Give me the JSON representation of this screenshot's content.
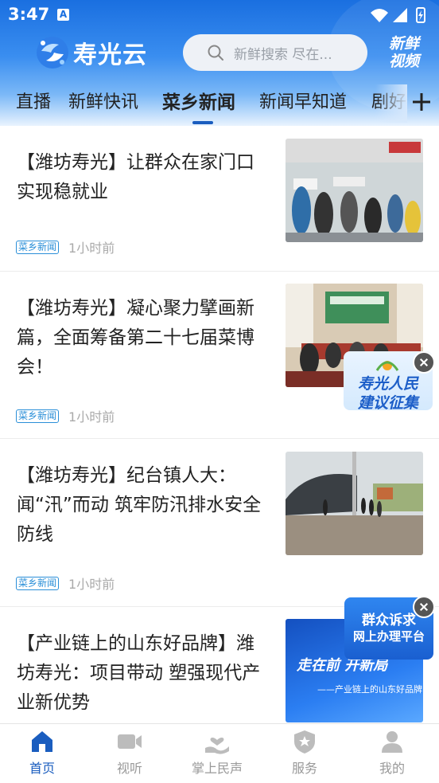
{
  "status": {
    "time": "3:47",
    "indicator": "A"
  },
  "header": {
    "app_name": "寿光云",
    "search_placeholder": "新鲜搜索  尽在...",
    "fresh_video": [
      "新鲜",
      "视频"
    ]
  },
  "tabs": [
    {
      "label": "直播"
    },
    {
      "label": "新鲜快讯"
    },
    {
      "label": "菜乡新闻",
      "active": true
    },
    {
      "label": "新闻早知道"
    },
    {
      "label": "剧好"
    }
  ],
  "articles": [
    {
      "title": "【潍坊寿光】让群众在家门口实现稳就业",
      "tag": "菜乡新闻",
      "time": "1小时前",
      "image": "job-fair-photo"
    },
    {
      "title": "【潍坊寿光】凝心聚力擘画新篇，全面筹备第二十七届菜博会！",
      "tag": "菜乡新闻",
      "time": "1小时前",
      "image": "meeting-room-photo"
    },
    {
      "title": "【潍坊寿光】纪台镇人大：闻“汛”而动  筑牢防汛排水安全防线",
      "tag": "菜乡新闻",
      "time": "1小时前",
      "image": "flood-inspection-photo"
    },
    {
      "title": "【产业链上的山东好品牌】潍坊寿光：项目带动  塑强现代产业新优势",
      "tag": "",
      "time": "",
      "image": "brand-banner",
      "banner_text": "走在前  开新局",
      "banner_sub": "——产业链上的山东好品牌"
    }
  ],
  "floating": {
    "suggestion": [
      "寿光人民",
      "建议征集"
    ],
    "appeal": [
      "群众诉求",
      "网上办理平台"
    ]
  },
  "nav": [
    {
      "label": "首页",
      "icon": "home-icon",
      "active": true
    },
    {
      "label": "视听",
      "icon": "video-icon"
    },
    {
      "label": "掌上民声",
      "icon": "heart-hand-icon"
    },
    {
      "label": "服务",
      "icon": "shield-service-icon"
    },
    {
      "label": "我的",
      "icon": "user-icon"
    }
  ],
  "colors": {
    "primary": "#1a6fe0",
    "active_nav": "#1a5dbf",
    "tag": "#2a8fd8"
  }
}
